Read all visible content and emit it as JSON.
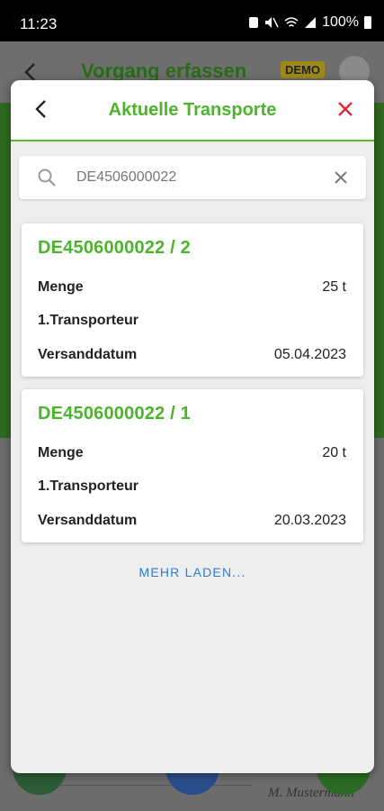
{
  "status_bar": {
    "time": "11:23",
    "battery": "100%"
  },
  "background": {
    "title": "Vorgang erfassen",
    "badge": "DEMO",
    "signature": "M. Mustermann"
  },
  "dialog": {
    "title": "Aktuelle Transporte",
    "search": {
      "value": "DE4506000022",
      "placeholder": ""
    },
    "transports": [
      {
        "id": "DE4506000022 / 2",
        "rows": [
          {
            "label": "Menge",
            "value": "25 t"
          },
          {
            "label": "1.Transporteur",
            "value": ""
          },
          {
            "label": "Versanddatum",
            "value": "05.04.2023"
          }
        ]
      },
      {
        "id": "DE4506000022 / 1",
        "rows": [
          {
            "label": "Menge",
            "value": "20 t"
          },
          {
            "label": "1.Transporteur",
            "value": ""
          },
          {
            "label": "Versanddatum",
            "value": "20.03.2023"
          }
        ]
      }
    ],
    "load_more": "MEHR LADEN..."
  },
  "colors": {
    "accent_green": "#4cb52b",
    "close_red": "#e0263a",
    "link_blue": "#2d7cd1"
  }
}
